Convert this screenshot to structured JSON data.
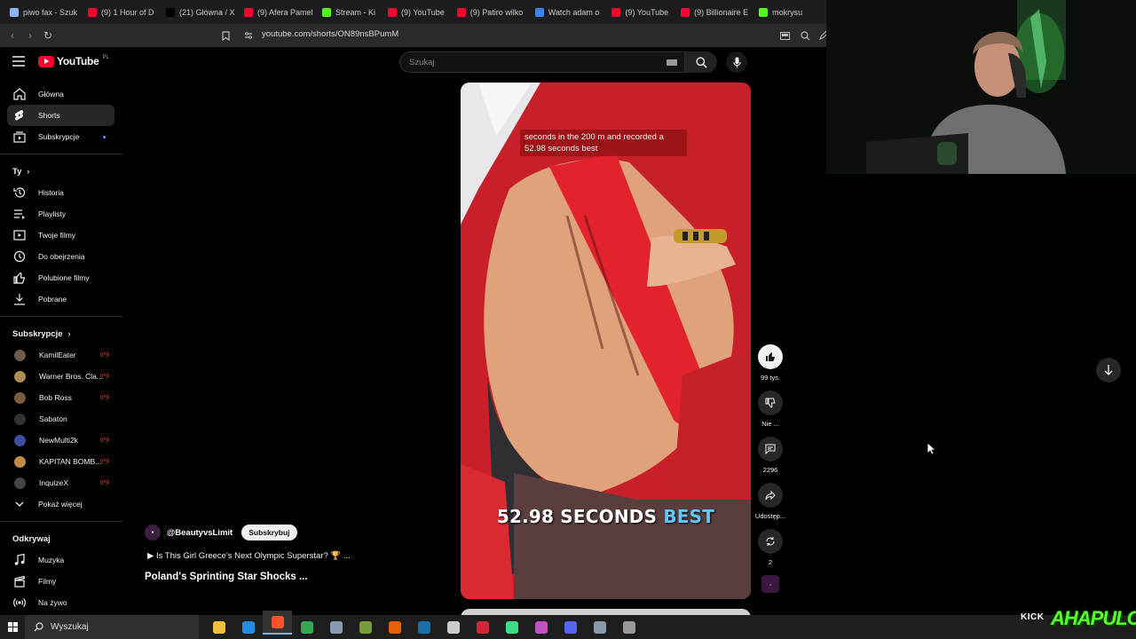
{
  "browser": {
    "tabs": [
      {
        "label": "piwo fax - Szuk",
        "color": "#8ab4f8",
        "icon": "google-icon"
      },
      {
        "label": "(9) 1 Hour of D",
        "color": "#ff0033",
        "icon": "youtube-icon"
      },
      {
        "label": "(21) Główna / X",
        "color": "#000000",
        "icon": "x-icon"
      },
      {
        "label": "(9) Afera Pamel",
        "color": "#ff0033",
        "icon": "youtube-icon"
      },
      {
        "label": "Stream - Ki",
        "color": "#53fc18",
        "icon": "kick-icon"
      },
      {
        "label": "(9) YouTube",
        "color": "#ff0033",
        "icon": "youtube-icon"
      },
      {
        "label": "(9) Patiro wilko",
        "color": "#ff0033",
        "icon": "youtube-icon"
      },
      {
        "label": "Watch adam o",
        "color": "#3b82f6",
        "icon": "watch-icon"
      },
      {
        "label": "(9) YouTube",
        "color": "#ff0033",
        "icon": "youtube-icon"
      },
      {
        "label": "(9) Billionaire E",
        "color": "#ff0033",
        "icon": "youtube-icon"
      },
      {
        "label": "mokrysu",
        "color": "#53fc18",
        "icon": "kick-icon"
      }
    ],
    "url": "youtube.com/shorts/ON89nsBPumM"
  },
  "youtube": {
    "logo_text": "YouTube",
    "country_code": "PL",
    "search_placeholder": "Szukaj"
  },
  "sidebar": {
    "main": [
      {
        "label": "Główna",
        "icon": "home-icon"
      },
      {
        "label": "Shorts",
        "icon": "shorts-icon",
        "active": true
      },
      {
        "label": "Subskrypcje",
        "icon": "subscriptions-icon",
        "dot": true
      }
    ],
    "you_heading": "Ty",
    "you": [
      {
        "label": "Historia",
        "icon": "history-icon"
      },
      {
        "label": "Playlisty",
        "icon": "playlist-icon"
      },
      {
        "label": "Twoje filmy",
        "icon": "your-videos-icon"
      },
      {
        "label": "Do obejrzenia",
        "icon": "watch-later-icon"
      },
      {
        "label": "Polubione filmy",
        "icon": "liked-icon"
      },
      {
        "label": "Pobrane",
        "icon": "download-icon"
      }
    ],
    "subs_heading": "Subskrypcje",
    "subs": [
      {
        "label": "KamilEater",
        "color": "#6b5a4d",
        "live": true
      },
      {
        "label": "Warner Bros. Cla...",
        "color": "#b08d57",
        "live": true
      },
      {
        "label": "Bob Ross",
        "color": "#7a5c3e",
        "live": true
      },
      {
        "label": "Sabaton",
        "color": "#333333",
        "live": false
      },
      {
        "label": "NewMulti2k",
        "color": "#3d4f9a",
        "live": true
      },
      {
        "label": "KAPITAN BOMB...",
        "color": "#c08a4a",
        "live": true
      },
      {
        "label": "InquizeX",
        "color": "#444444",
        "live": true
      }
    ],
    "show_more": "Pokaż więcej",
    "explore_heading": "Odkrywaj",
    "explore": [
      {
        "label": "Muzyka",
        "icon": "music-icon"
      },
      {
        "label": "Filmy",
        "icon": "film-icon"
      },
      {
        "label": "Na żywo",
        "icon": "live-icon"
      }
    ]
  },
  "short": {
    "caption_top": "seconds in the 200 m and recorded a 52.98 seconds best",
    "caption_big_main": "52.98 SECONDS ",
    "caption_big_accent": "BEST",
    "tape_text": "POLAND!",
    "channel": "@BeautyvsLimit",
    "subscribe_label": "Subskrybuj",
    "description": "▶ Is This Girl Greece's Next Olympic Superstar? 🏆 ...",
    "title": "Poland's Sprinting Star Shocks ..."
  },
  "actions": {
    "likes": "99 tys.",
    "dislike": "Nie ...",
    "comments": "2296",
    "share": "Udostęp...",
    "remix": "2"
  },
  "taskbar": {
    "search_placeholder": "Wyszukaj",
    "overlay_kick": "KICK",
    "overlay_brand": "AHAPULCO",
    "apps": [
      {
        "name": "explorer-icon",
        "color": "#f0c23a"
      },
      {
        "name": "edge-icon",
        "color": "#1f8de0"
      },
      {
        "name": "brave-icon",
        "color": "#fb542b",
        "active": true
      },
      {
        "name": "chrome-icon",
        "color": "#34a853"
      },
      {
        "name": "app-icon",
        "color": "#8a9bb0"
      },
      {
        "name": "minecraft-icon",
        "color": "#7a9b3b"
      },
      {
        "name": "firefox-icon",
        "color": "#e66000"
      },
      {
        "name": "steam-icon",
        "color": "#1b6fa8"
      },
      {
        "name": "settings-icon",
        "color": "#cccccc"
      },
      {
        "name": "obs-icon",
        "color": "#d0283a"
      },
      {
        "name": "play-icon",
        "color": "#3ddc84"
      },
      {
        "name": "app2-icon",
        "color": "#c04fc0"
      },
      {
        "name": "discord-icon",
        "color": "#5865f2"
      },
      {
        "name": "app3-icon",
        "color": "#8899aa"
      },
      {
        "name": "app4-icon",
        "color": "#999999"
      }
    ]
  }
}
